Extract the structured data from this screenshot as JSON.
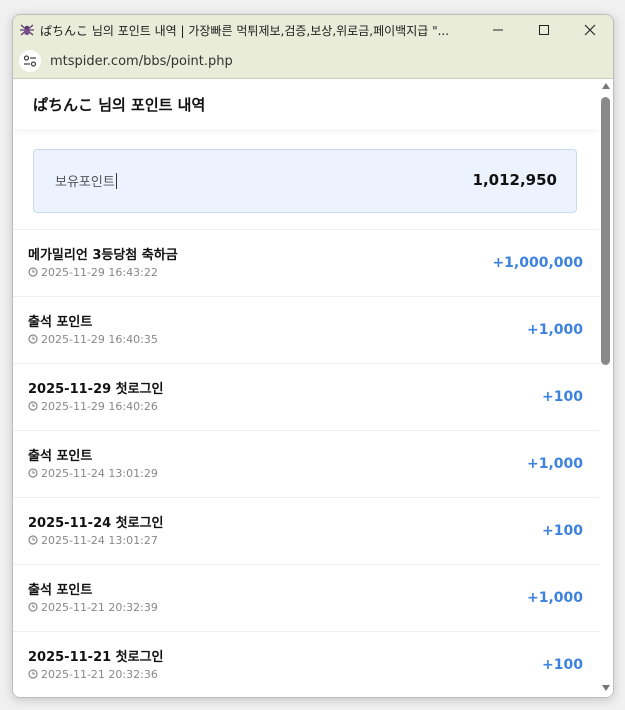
{
  "window": {
    "title": "ぱちんこ 님의 포인트 내역 | 가장빠른 먹튀제보,검증,보상,위로금,페이백지급 \"...",
    "favicon": "spider-icon",
    "controls": [
      "minimize-icon",
      "maximize-icon",
      "close-icon"
    ]
  },
  "browser": {
    "url": "mtspider.com/bbs/point.php",
    "site_icon": "site-info-icon"
  },
  "page": {
    "title": "ぱちんこ 님의 포인트 내역"
  },
  "balance": {
    "label": "보유포인트",
    "value": "1,012,950"
  },
  "history": [
    {
      "title": "메가밀리언 3등당첨 축하금",
      "time": "2025-11-29 16:43:22",
      "points": "+1,000,000"
    },
    {
      "title": "출석 포인트",
      "time": "2025-11-29 16:40:35",
      "points": "+1,000"
    },
    {
      "title": "2025-11-29 첫로그인",
      "time": "2025-11-29 16:40:26",
      "points": "+100"
    },
    {
      "title": "출석 포인트",
      "time": "2025-11-24 13:01:29",
      "points": "+1,000"
    },
    {
      "title": "2025-11-24 첫로그인",
      "time": "2025-11-24 13:01:27",
      "points": "+100"
    },
    {
      "title": "출석 포인트",
      "time": "2025-11-21 20:32:39",
      "points": "+1,000"
    },
    {
      "title": "2025-11-21 첫로그인",
      "time": "2025-11-21 20:32:36",
      "points": "+100"
    }
  ],
  "colors": {
    "titlebar_bg": "#e8ecd8",
    "balance_bg": "#ecf3fe",
    "points_accent": "#3d82e0"
  }
}
